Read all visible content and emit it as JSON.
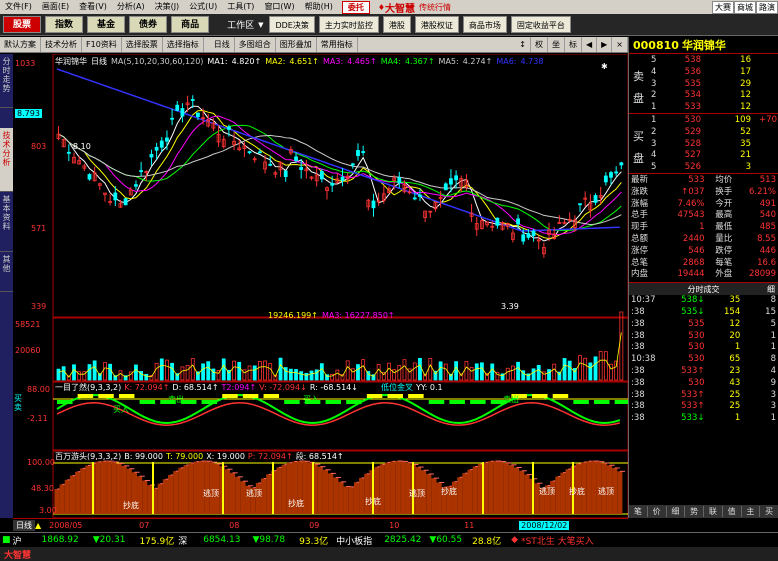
{
  "menu": [
    "文件(F)",
    "画面(E)",
    "查看(V)",
    "分析(A)",
    "决策(J)",
    "公式(U)",
    "工具(T)",
    "窗口(W)",
    "帮助(H)"
  ],
  "order_label": "委托",
  "brand": "大智慧",
  "brand_sub": "传统行情",
  "top_right": [
    "大赛",
    "商城",
    "路演"
  ],
  "tabs": [
    "股票",
    "指数",
    "基金",
    "债券",
    "商品"
  ],
  "workspace": "工作区",
  "tabs2": [
    "DDE决策",
    "主力实时监控",
    "港股",
    "港股权证",
    "商品市场",
    "固定收益平台"
  ],
  "toolbar": [
    "默认方案",
    "技术分析",
    "F10资料",
    "选择股票",
    "选择指标",
    "日线",
    "多图组合",
    "图形叠加",
    "常用指标"
  ],
  "toolbar_right": [
    "权",
    "坐",
    "标"
  ],
  "sidebar": [
    "分时走势",
    "技术分析",
    "基本资料",
    "其他"
  ],
  "stock": {
    "code": "000810",
    "name": "华润锦华"
  },
  "price_axis": {
    "labels": [
      "1033",
      "803",
      "571",
      "339"
    ],
    "current": "8.793"
  },
  "ma_line": {
    "name": "华润锦华",
    "period": "日线",
    "params": "MA(5,10,20,30,60,120)",
    "items": [
      {
        "k": "MA1:",
        "v": "4.820↑",
        "c": "#fff"
      },
      {
        "k": "MA2:",
        "v": "4.651↑",
        "c": "#ff0"
      },
      {
        "k": "MA3:",
        "v": "4.465↑",
        "c": "#f0f"
      },
      {
        "k": "MA4:",
        "v": "4.367↑",
        "c": "#0f0"
      },
      {
        "k": "MA5:",
        "v": "4.274↑",
        "c": "#ccc"
      },
      {
        "k": "MA6:",
        "v": "4.738",
        "c": "#33f"
      }
    ]
  },
  "price_annot": {
    "high": "8.10",
    "low": "3.39"
  },
  "vol": {
    "labels": [
      "58521",
      "20060"
    ],
    "ma2": "19246.199↑",
    "ma3": "MA3: 16227.850↑"
  },
  "ind1": {
    "name": "一目了然(9,3,3,2)",
    "k": "K: 72.094↑",
    "d": "D: 68.514↑",
    "t": "T2:094↑",
    "v": "V: -72.094↓",
    "r": "R: -68.514↓",
    "hint": "低位金叉",
    "yy": "YY: 0.1",
    "labels": [
      "88.00",
      "-2.11"
    ],
    "tag": "买卖",
    "annot": [
      "买入",
      "卖出",
      "买入",
      "卖出"
    ]
  },
  "ind2": {
    "name": "百万游头(9,3,3,2)",
    "b": "B: 99.000",
    "t": "T: 79.000",
    "x": "X: 19.000",
    "p": "P: 72.094↑",
    "y": "段: 68.514↑",
    "labels": [
      "100.00",
      "48.30",
      "3.00"
    ],
    "annot": [
      "逃顶",
      "逃顶",
      "抄底",
      "抄底",
      "逃顶",
      "抄底",
      "抄底",
      "逃顶",
      "抄底",
      "逃顶"
    ]
  },
  "time_axis": {
    "left": "日线",
    "dates": [
      "2008/05",
      "07",
      "08",
      "09",
      "10",
      "11"
    ],
    "current": "2008/12/02"
  },
  "right": {
    "sell_label": "卖盘",
    "buy_label": "买盘",
    "sell": [
      [
        "5",
        "538",
        "16"
      ],
      [
        "4",
        "536",
        "17"
      ],
      [
        "3",
        "535",
        "29"
      ],
      [
        "2",
        "534",
        "12"
      ],
      [
        "1",
        "533",
        "12"
      ]
    ],
    "buy": [
      [
        "1",
        "530",
        "109",
        "+70"
      ],
      [
        "2",
        "529",
        "52",
        ""
      ],
      [
        "3",
        "528",
        "35",
        ""
      ],
      [
        "4",
        "527",
        "21",
        ""
      ],
      [
        "5",
        "526",
        "3",
        ""
      ]
    ],
    "stats": [
      [
        "最新",
        "533",
        "均价",
        "513"
      ],
      [
        "涨跌",
        "↑037",
        "换手",
        "6.21%"
      ],
      [
        "涨幅",
        "7.46%",
        "今开",
        "491"
      ],
      [
        "总手",
        "47543",
        "最高",
        "540"
      ],
      [
        "现手",
        "1",
        "最低",
        "485"
      ],
      [
        "总额",
        "2440",
        "量比",
        "8.55"
      ],
      [
        "涨停",
        "546",
        "跌停",
        "446"
      ],
      [
        "总笔",
        "2868",
        "每笔",
        "16.6"
      ],
      [
        "内盘",
        "19444",
        "外盘",
        "28099"
      ]
    ],
    "tick_header": "分时成交",
    "tick_header_right": "细",
    "ticks": [
      [
        "10:37",
        "538↓",
        "35",
        "8"
      ],
      [
        ":38",
        "535↓",
        "154",
        "15"
      ],
      [
        ":38",
        "535",
        "12",
        "5"
      ],
      [
        ":38",
        "530",
        "20",
        "1"
      ],
      [
        ":38",
        "530",
        "1",
        "1"
      ],
      [
        "10:38",
        "530",
        "65",
        "8"
      ],
      [
        ":38",
        "533↑",
        "23",
        "4"
      ],
      [
        ":38",
        "530",
        "43",
        "9"
      ],
      [
        ":38",
        "533↑",
        "25",
        "3"
      ],
      [
        ":38",
        "533↑",
        "25",
        "3"
      ],
      [
        ":38",
        "533↓",
        "1",
        "1"
      ]
    ],
    "tabs": [
      "笔",
      "价",
      "细",
      "势",
      "联",
      "值",
      "主",
      "买"
    ]
  },
  "status": {
    "sh_label": "沪",
    "sh_index": "1868.92",
    "sh_chg": "▼20.31",
    "sh_amt": "175.9亿",
    "sz_label": "深",
    "sz_index": "6854.13",
    "sz_chg": "▼98.78",
    "sz_amt": "93.3亿",
    "zx_label": "中小板指",
    "zx_index": "2825.42",
    "zx_chg": "▼60.55",
    "zx_amt": "28.8亿",
    "alert": "*ST北生 大笔买入"
  },
  "bottom": {
    "brand": "大智慧"
  },
  "chart_data": {
    "type": "candlestick",
    "title": "华润锦华 日线",
    "ylabels": [
      "1033",
      "803",
      "571",
      "339"
    ]
  }
}
